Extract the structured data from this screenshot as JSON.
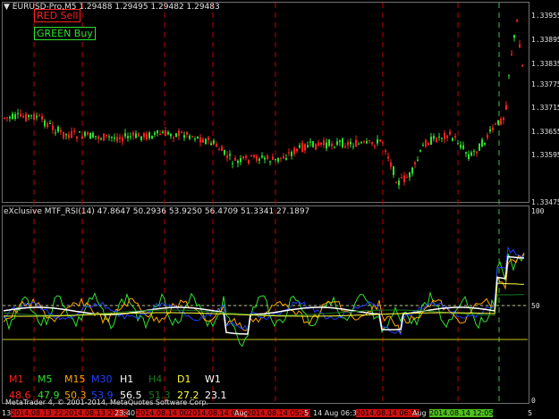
{
  "main_chart": {
    "symbol_header": "EURUSD-Pro,M5  1.29488 1.29495 1.29482 1.29483",
    "buttons": {
      "sell": "RED Sell",
      "buy": "GREEN Buy"
    },
    "price_labels": [
      "1.33955",
      "1.33895",
      "1.33835",
      "1.33775",
      "1.33715",
      "1.33655",
      "1.33595",
      "1.33475"
    ]
  },
  "indicator": {
    "header": "eXclusive MTF_RSI(14) 47.8647 50.2936 53.9250 56.4709 51.3341 27.1897",
    "levels": [
      "100",
      "50",
      "0"
    ],
    "timeframes": [
      {
        "label": "M1",
        "value": "48.6",
        "color": "#ff2020"
      },
      {
        "label": "M5",
        "value": "47.9",
        "color": "#30e030"
      },
      {
        "label": "M15",
        "value": "50.3",
        "color": "#ffa500"
      },
      {
        "label": "M30",
        "value": "53.9",
        "color": "#2040ff"
      },
      {
        "label": "H1",
        "value": "56.5",
        "color": "#ffffff"
      },
      {
        "label": "H4",
        "value": "51.3",
        "color": "#1a7a1a"
      },
      {
        "label": "D1",
        "value": "27.2",
        "color": "#ffff40"
      },
      {
        "label": "W1",
        "value": "23.1",
        "color": "#ffffff"
      }
    ]
  },
  "footer": {
    "copyright": "MetaTrader 4, © 2001-2014, MetaQuotes Software Corp.",
    "time_labels": [
      "13",
      "2014.08.13 22:45",
      "2014.08.13 23:10",
      "23:40",
      "2014.08.14 00:05",
      "2014.08.14 00:55",
      "Aug",
      "2014.08.14 05:20",
      "5",
      "14 Aug 06:35",
      "2014.08.14 06:55",
      "Aug",
      "2014.08.14 12:05",
      "5"
    ]
  },
  "colors": {
    "background": "#000000",
    "bull": "#30e030",
    "bear": "#ff2020",
    "separator": "#c00000",
    "current": "#40c040"
  }
}
